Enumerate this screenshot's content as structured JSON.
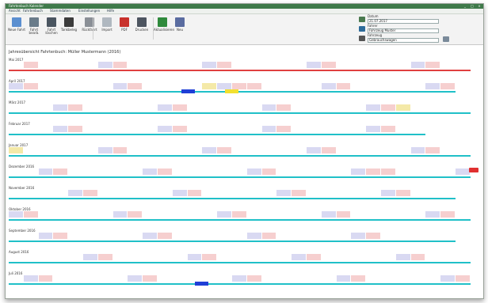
{
  "window": {
    "title": "Fahrtenbuch Kalender"
  },
  "titlebar": {
    "minimize": "_",
    "maximize": "□",
    "close": "×"
  },
  "menu": [
    {
      "label": "Ansicht",
      "active": true
    },
    {
      "label": "Fahrtenbuch",
      "active": false
    },
    {
      "label": "Stammdaten",
      "active": false
    },
    {
      "label": "Einstellungen",
      "active": false
    },
    {
      "label": "Hilfe",
      "active": false
    }
  ],
  "ribbon": {
    "buttons": [
      {
        "label": "Neue Fahrt",
        "icon": "new-trip-icon",
        "color": "#5b8fd0"
      },
      {
        "label": "Fahrt bearb.",
        "icon": "edit-trip-icon",
        "color": "#6a7c8a"
      },
      {
        "label": "Fahrt löschen",
        "icon": "delete-trip-icon",
        "color": "#4a5560"
      },
      {
        "label": "Tankbeleg",
        "icon": "fuel-receipt-icon",
        "color": "#3c3c3c"
      },
      {
        "label": "Rückfahrt",
        "icon": "return-trip-icon",
        "color": "#8a8f96"
      },
      {
        "label": "Import",
        "icon": "import-icon",
        "color": "#b0b8c0"
      },
      {
        "label": "PDF",
        "icon": "pdf-icon",
        "color": "#c8312b"
      },
      {
        "label": "Drucken",
        "icon": "print-icon",
        "color": "#4d5560"
      },
      {
        "label": "Aktualisieren",
        "icon": "refresh-icon",
        "color": "#2f8a3c"
      },
      {
        "label": "Neu",
        "icon": "new-icon",
        "color": "#5a6ca0"
      }
    ],
    "fields": [
      {
        "label": "Datum",
        "value": "21.07.2017"
      },
      {
        "label": "Fahrer",
        "value": "Fahrzeug Muster"
      },
      {
        "label": "Fahrzeug",
        "value": "Gebrauchswagen"
      }
    ]
  },
  "content": {
    "heading": "Jahresübersicht Fahrtenbuch: Müller Mustermann (2016)",
    "months": [
      {
        "label": "Mai 2017",
        "line_color": "#e04040",
        "cells": 31,
        "highlights": {
          "1": "#f6cfcf",
          "6": "#d9d9f2",
          "7": "#f6cfcf",
          "13": "#d9d9f2",
          "14": "#f6cfcf",
          "20": "#d9d9f2",
          "21": "#f6cfcf",
          "27": "#d9d9f2",
          "28": "#f6cfcf"
        }
      },
      {
        "label": "April 2017",
        "line_color": "#20c0c8",
        "cells": 30,
        "highlights": {
          "0": "#d9d9f2",
          "1": "#f6cfcf",
          "7": "#d9d9f2",
          "8": "#f6cfcf",
          "13": "#f4e9a8",
          "14": "#d9d9f2",
          "15": "#f6cfcf",
          "16": "#f6cfcf",
          "21": "#d9d9f2",
          "22": "#f6cfcf",
          "28": "#d9d9f2",
          "29": "#f6cfcf"
        }
      },
      {
        "label": "März 2017",
        "line_color": "#20c0c8",
        "cells": 31,
        "highlights": {
          "3": "#d9d9f2",
          "4": "#f6cfcf",
          "10": "#d9d9f2",
          "11": "#f6cfcf",
          "17": "#d9d9f2",
          "18": "#f6cfcf",
          "24": "#d9d9f2",
          "25": "#f6cfcf",
          "26": "#f4e9a8"
        }
      },
      {
        "label": "Februar 2017",
        "line_color": "#20c0c8",
        "cells": 28,
        "highlights": {
          "3": "#d9d9f2",
          "4": "#f6cfcf",
          "10": "#d9d9f2",
          "11": "#f6cfcf",
          "17": "#d9d9f2",
          "18": "#f6cfcf",
          "24": "#d9d9f2",
          "25": "#f6cfcf"
        }
      },
      {
        "label": "Januar 2017",
        "line_color": "#20c0c8",
        "cells": 31,
        "highlights": {
          "0": "#f4e9a8",
          "6": "#d9d9f2",
          "7": "#f6cfcf",
          "13": "#d9d9f2",
          "14": "#f6cfcf",
          "20": "#d9d9f2",
          "21": "#f6cfcf",
          "27": "#d9d9f2",
          "28": "#f6cfcf"
        }
      },
      {
        "label": "Dezember 2016",
        "line_color": "#20c0c8",
        "cells": 31,
        "highlights": {
          "2": "#d9d9f2",
          "3": "#f6cfcf",
          "9": "#d9d9f2",
          "10": "#f6cfcf",
          "16": "#d9d9f2",
          "17": "#f6cfcf",
          "23": "#d9d9f2",
          "24": "#f6cfcf",
          "25": "#f6cfcf",
          "30": "#d9d9f2"
        }
      },
      {
        "label": "November 2016",
        "line_color": "#20c0c8",
        "cells": 30,
        "highlights": {
          "4": "#d9d9f2",
          "5": "#f6cfcf",
          "11": "#d9d9f2",
          "12": "#f6cfcf",
          "18": "#d9d9f2",
          "19": "#f6cfcf",
          "25": "#d9d9f2",
          "26": "#f6cfcf"
        }
      },
      {
        "label": "Oktober 2016",
        "line_color": "#20c0c8",
        "cells": 31,
        "highlights": {
          "0": "#d9d9f2",
          "1": "#f6cfcf",
          "7": "#d9d9f2",
          "8": "#f6cfcf",
          "14": "#d9d9f2",
          "15": "#f6cfcf",
          "21": "#d9d9f2",
          "22": "#f6cfcf",
          "28": "#d9d9f2",
          "29": "#f6cfcf"
        }
      },
      {
        "label": "September 2016",
        "line_color": "#20c0c8",
        "cells": 30,
        "highlights": {
          "2": "#d9d9f2",
          "3": "#f6cfcf",
          "9": "#d9d9f2",
          "10": "#f6cfcf",
          "16": "#d9d9f2",
          "17": "#f6cfcf",
          "23": "#d9d9f2",
          "24": "#f6cfcf"
        }
      },
      {
        "label": "August 2016",
        "line_color": "#20c0c8",
        "cells": 31,
        "highlights": {
          "5": "#d9d9f2",
          "6": "#f6cfcf",
          "12": "#d9d9f2",
          "13": "#f6cfcf",
          "19": "#d9d9f2",
          "20": "#f6cfcf",
          "26": "#d9d9f2",
          "27": "#f6cfcf"
        }
      },
      {
        "label": "Juli 2016",
        "line_color": "#20c0c8",
        "cells": 31,
        "highlights": {
          "1": "#d9d9f2",
          "2": "#f6cfcf",
          "8": "#d9d9f2",
          "9": "#f6cfcf",
          "15": "#d9d9f2",
          "16": "#f6cfcf",
          "22": "#d9d9f2",
          "23": "#f6cfcf",
          "29": "#d9d9f2",
          "30": "#f6cfcf"
        }
      }
    ]
  }
}
